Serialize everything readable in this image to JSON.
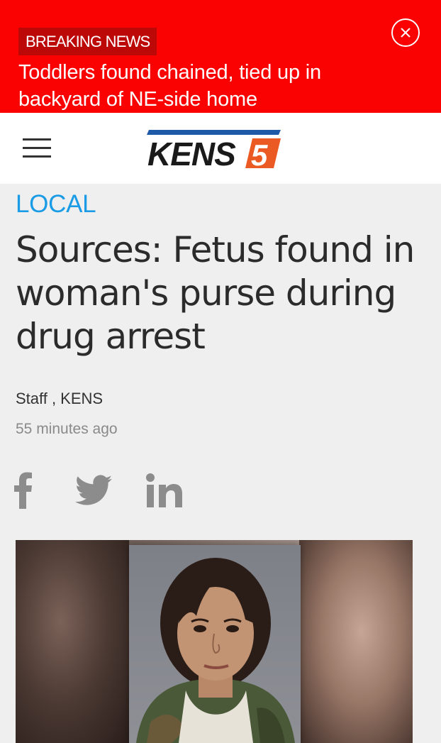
{
  "breaking": {
    "badge": "BREAKING NEWS",
    "headline": "Toddlers found chained, tied up in backyard of NE-side home",
    "close_icon": "close-circle-icon"
  },
  "header": {
    "menu_icon": "hamburger-menu-icon",
    "logo_text": "KENS",
    "logo_number": "5"
  },
  "article": {
    "section": "LOCAL",
    "title": "Sources: Fetus found in woman's purse during drug arrest",
    "byline": "Staff , KENS",
    "timestamp": "55 minutes ago",
    "share_icons": [
      "facebook-icon",
      "twitter-icon",
      "linkedin-icon"
    ]
  },
  "colors": {
    "banner_red": "#fa0202",
    "badge_red": "#bd0808",
    "section_blue": "#1a9be6",
    "logo_blue": "#1e5aa8",
    "logo_orange": "#ec5a24"
  }
}
